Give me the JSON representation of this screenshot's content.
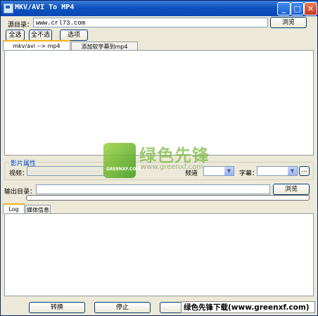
{
  "window": {
    "title": "MKV/AVI To MP4",
    "minimize": "_",
    "maximize": "□",
    "close": "✕"
  },
  "source": {
    "label": "源目录：",
    "value": "www.crl73.com",
    "browse": "浏览"
  },
  "toolbar": {
    "select_all": "全选",
    "select_none": "全不选",
    "options": "选项"
  },
  "tabs": [
    {
      "label": "mkv/avi --> mp4"
    },
    {
      "label": "添加软字幕到mp4"
    }
  ],
  "movie_props": {
    "legend": "影片属性",
    "video_label": "视频：",
    "audio_label": "频道",
    "subtitle_label": "字幕：",
    "more": "..."
  },
  "output": {
    "label": "输出目录：",
    "browse": "浏览"
  },
  "log_tabs": [
    {
      "label": "Log"
    },
    {
      "label": "媒体信息"
    }
  ],
  "actions": {
    "convert": "转换",
    "stop": "停止",
    "third": ""
  },
  "watermark": {
    "logo_text": "GREENXF.COM",
    "big_text": "绿色先锋",
    "url": "www.greenxf.com",
    "banner": "绿色先锋下载(www.greenxf.com)"
  },
  "icons": {
    "combo_arrow": "chevron-down-icon",
    "app": "app-icon"
  }
}
